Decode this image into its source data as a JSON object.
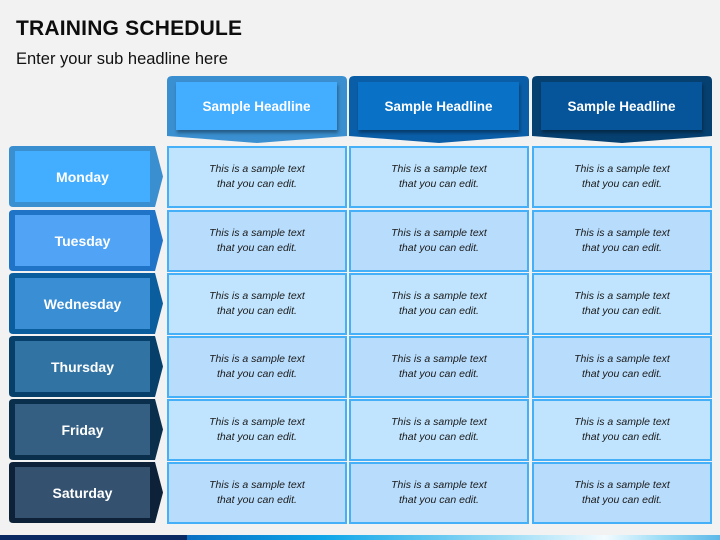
{
  "header": {
    "title": "TRAINING SCHEDULE",
    "subtitle": "Enter your sub headline here"
  },
  "columns": [
    {
      "label": "Sample Headline",
      "outer_color": "#3a8fd0",
      "inner_color": "#43adff"
    },
    {
      "label": "Sample Headline",
      "outer_color": "#0a5ea8",
      "inner_color": "#0a72c6"
    },
    {
      "label": "Sample Headline",
      "outer_color": "#064070",
      "inner_color": "#06559a"
    }
  ],
  "rows": [
    {
      "day": "Monday",
      "outer_color": "#3a8fd0",
      "inner_color": "#43adff",
      "cells": [
        "This is a sample text that you can edit.",
        "This is a sample text that you can edit.",
        "This is a sample text that you can edit."
      ]
    },
    {
      "day": "Tuesday",
      "outer_color": "#2074c8",
      "inner_color": "#51a4f5",
      "cells": [
        "This is a sample text that you can edit.",
        "This is a sample text that you can edit.",
        "This is a sample text that you can edit."
      ]
    },
    {
      "day": "Wednesday",
      "outer_color": "#0a5e9e",
      "inner_color": "#3a8ed3",
      "cells": [
        "This is a sample text that you can edit.",
        "This is a sample text that you can edit.",
        "This is a sample text that you can edit."
      ]
    },
    {
      "day": "Thursday",
      "outer_color": "#063f6a",
      "inner_color": "#3174a4",
      "cells": [
        "This is a sample text that you can edit.",
        "This is a sample text that you can edit.",
        "This is a sample text that you can edit."
      ]
    },
    {
      "day": "Friday",
      "outer_color": "#0a2f4d",
      "inner_color": "#345f82",
      "cells": [
        "This is a sample text that you can edit.",
        "This is a sample text that you can edit.",
        "This is a sample text that you can edit."
      ]
    },
    {
      "day": "Saturday",
      "outer_color": "#0d2238",
      "inner_color": "#34526f",
      "cells": [
        "This is a sample text that you can edit.",
        "This is a sample text that you can edit.",
        "This is a sample text that you can edit."
      ]
    }
  ],
  "cell_line1": "This is a sample text",
  "cell_line2": "that you can edit."
}
